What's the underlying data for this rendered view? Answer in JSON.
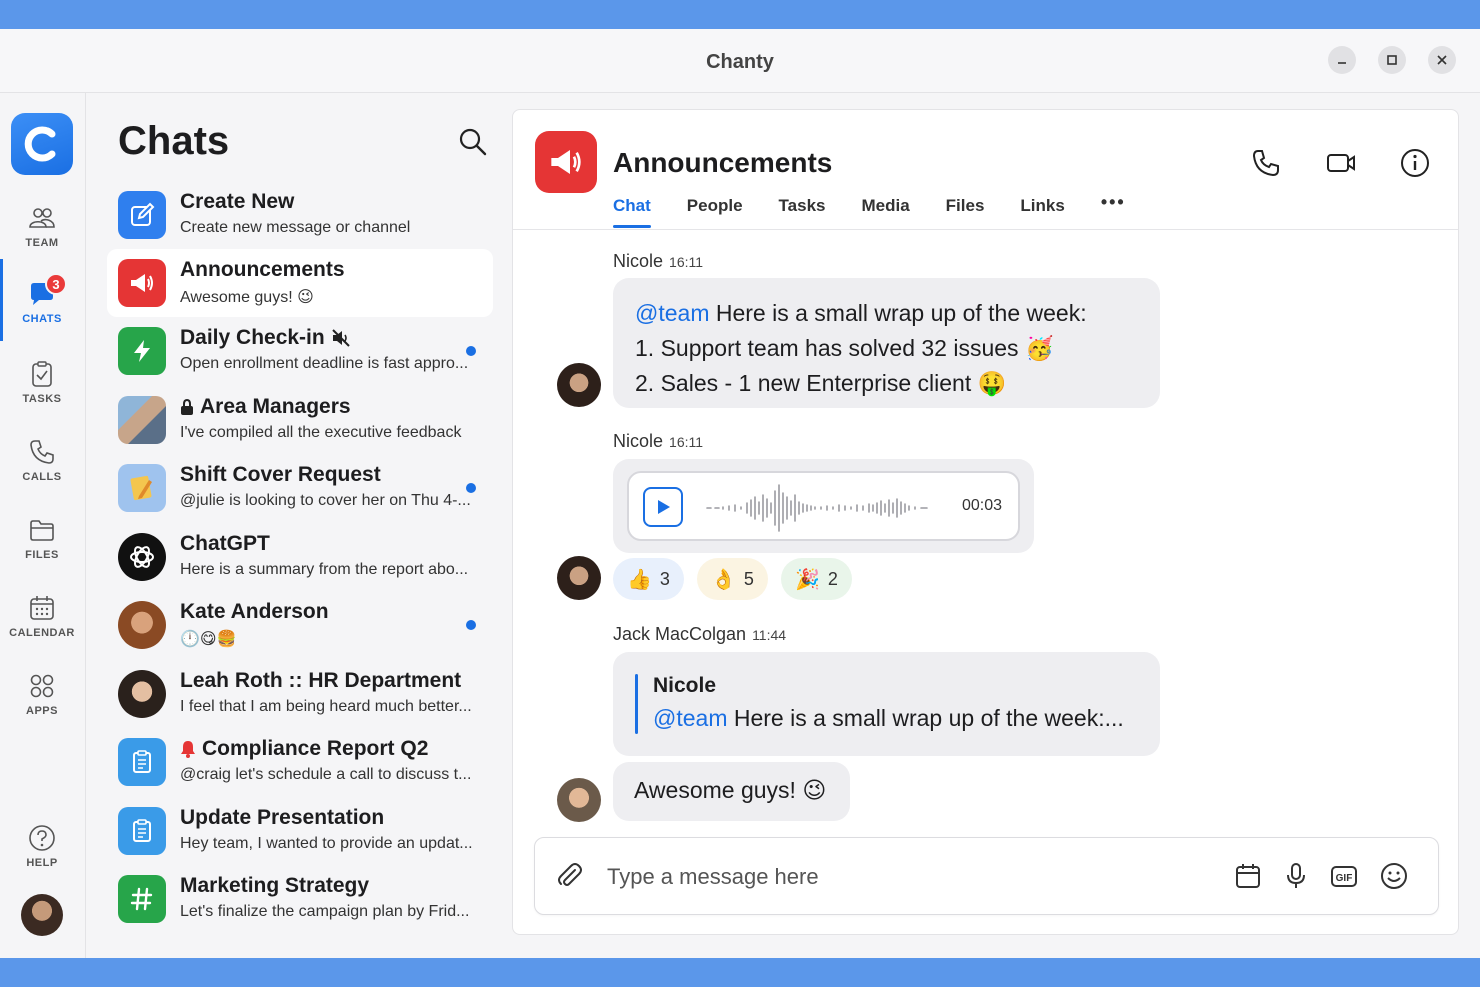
{
  "window": {
    "title": "Chanty"
  },
  "rail": {
    "items": [
      {
        "label": "TEAM",
        "icon": "team-icon"
      },
      {
        "label": "CHATS",
        "icon": "chat-bubble-icon",
        "badge": "3"
      },
      {
        "label": "TASKS",
        "icon": "clipboard-check-icon"
      },
      {
        "label": "CALLS",
        "icon": "phone-icon"
      },
      {
        "label": "FILES",
        "icon": "folder-icon"
      },
      {
        "label": "CALENDAR",
        "icon": "calendar-icon"
      },
      {
        "label": "APPS",
        "icon": "apps-grid-icon"
      },
      {
        "label": "HELP",
        "icon": "help-circle-icon"
      }
    ],
    "active": "CHATS"
  },
  "chat_list": {
    "title": "Chats",
    "items": [
      {
        "name": "Create New",
        "preview": "Create new message or channel",
        "icon": "compose-icon",
        "color": "#2f7fee"
      },
      {
        "name": "Announcements",
        "preview": "Awesome guys! 😉",
        "icon": "megaphone-icon",
        "color": "#e53535",
        "active": true
      },
      {
        "name": "Daily Check-in",
        "preview": "Open enrollment deadline is fast appro...",
        "icon": "lightning-icon",
        "color": "#27a54a",
        "muted": true,
        "unread": true
      },
      {
        "name": "Area Managers",
        "preview": "I've compiled all the executive feedback",
        "icon": "group-photo",
        "private": true
      },
      {
        "name": "Shift Cover Request",
        "preview": "@julie is looking to cover her on Thu 4-...",
        "icon": "note-pencil-icon",
        "color": "#7fb0e8",
        "unread": true
      },
      {
        "name": "ChatGPT",
        "preview": "Here is a summary from the report abo...",
        "icon": "openai-icon",
        "color": "#111111"
      },
      {
        "name": "Kate Anderson",
        "preview": "🕛😋🍔",
        "icon": "avatar-photo",
        "unread": true
      },
      {
        "name": "Leah Roth :: HR Department",
        "preview": "I feel that I am being heard much better...",
        "icon": "avatar-photo"
      },
      {
        "name": "Compliance Report Q2",
        "preview": "@craig let's schedule a call to discuss t...",
        "icon": "clipboard-list-icon",
        "color": "#3a9be8",
        "notify": true
      },
      {
        "name": "Update Presentation",
        "preview": "Hey team, I wanted to provide an updat...",
        "icon": "clipboard-list-icon",
        "color": "#3a9be8"
      },
      {
        "name": "Marketing Strategy",
        "preview": "Let's finalize the campaign plan by Frid...",
        "icon": "hashtag-icon",
        "color": "#27a54a"
      }
    ]
  },
  "conversation": {
    "title": "Announcements",
    "tabs": [
      "Chat",
      "People",
      "Tasks",
      "Media",
      "Files",
      "Links",
      "•••"
    ],
    "active_tab": "Chat",
    "messages": [
      {
        "sender": "Nicole",
        "time": "16:11",
        "mention": "@team",
        "line1": " Here is a small wrap up of the week:",
        "line2": "1. Support team has solved 32 issues 🥳",
        "line3": "2. Sales - 1 new Enterprise client 🤑"
      },
      {
        "sender": "Nicole",
        "time": "16:11",
        "voice_duration": "00:03",
        "reactions": [
          {
            "emoji": "👍",
            "count": "3"
          },
          {
            "emoji": "👌",
            "count": "5"
          },
          {
            "emoji": "🎉",
            "count": "2"
          }
        ]
      },
      {
        "sender": "Jack MacColgan",
        "time": "11:44",
        "quote_author": "Nicole",
        "quote_mention": "@team",
        "quote_text": " Here is a small wrap up of the week:...",
        "text": "Awesome guys! 😉"
      }
    ],
    "composer_placeholder": "Type a message here"
  },
  "colors": {
    "accent": "#1a6fe3",
    "badge": "#ea3a3a",
    "background": "#5b97ea"
  }
}
